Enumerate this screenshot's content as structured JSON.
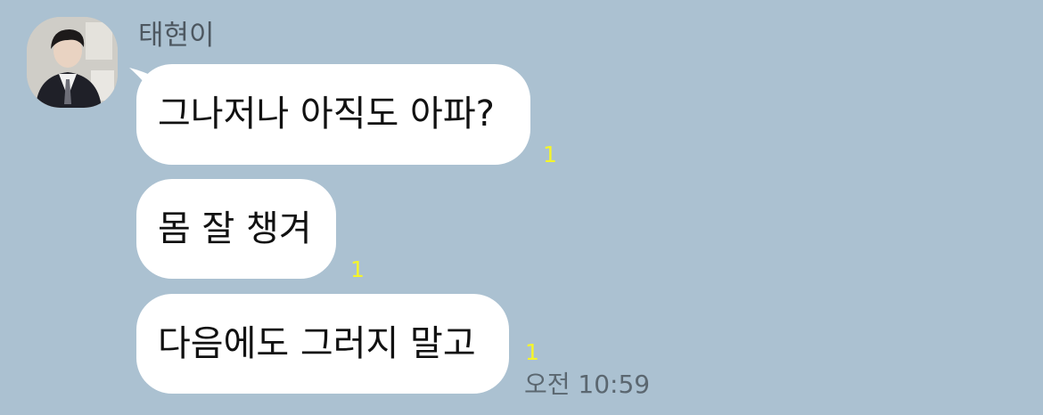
{
  "chat": {
    "sender_name": "태현이",
    "avatar_icon": "profile-photo-avatar",
    "messages": [
      {
        "text": "그나저나 아직도 아파?",
        "unread": "1"
      },
      {
        "text": "몸 잘 챙겨",
        "unread": "1"
      },
      {
        "text": "다음에도 그러지 말고",
        "unread": "1"
      }
    ],
    "timestamp": "오전 10:59"
  },
  "colors": {
    "background": "#abc1d1",
    "bubble": "#ffffff",
    "unread": "#f5f52a",
    "timestamp": "#5b6770",
    "sender_name": "#4d5760"
  }
}
